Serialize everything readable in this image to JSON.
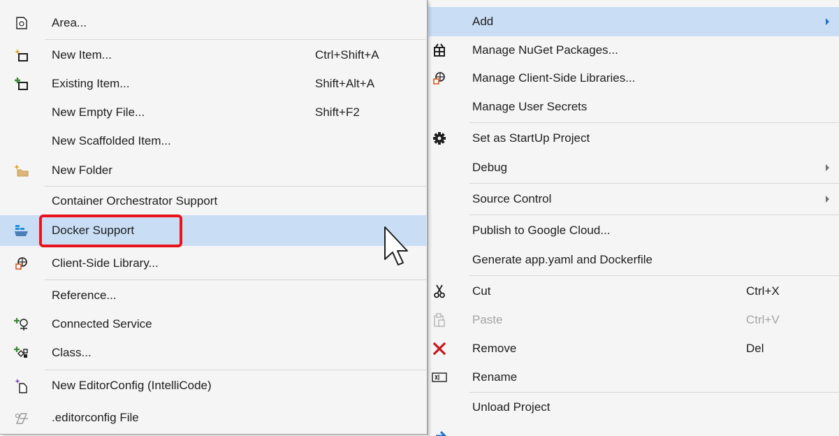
{
  "add_submenu": {
    "items": [
      {
        "label": "Area...",
        "shortcut": "",
        "icon": "area-icon"
      },
      {
        "label": "New Item...",
        "shortcut": "Ctrl+Shift+A",
        "icon": "new-item-icon"
      },
      {
        "label": "Existing Item...",
        "shortcut": "Shift+Alt+A",
        "icon": "existing-item-icon"
      },
      {
        "label": "New Empty File...",
        "shortcut": "Shift+F2",
        "icon": ""
      },
      {
        "label": "New Scaffolded Item...",
        "shortcut": "",
        "icon": ""
      },
      {
        "label": "New Folder",
        "shortcut": "",
        "icon": "new-folder-icon"
      },
      {
        "label": "Container Orchestrator Support",
        "shortcut": "",
        "icon": ""
      },
      {
        "label": "Docker Support",
        "shortcut": "",
        "icon": "docker-icon",
        "highlighted": true
      },
      {
        "label": "Client-Side Library...",
        "shortcut": "",
        "icon": "client-library-icon"
      },
      {
        "label": "Reference...",
        "shortcut": "",
        "icon": ""
      },
      {
        "label": "Connected Service",
        "shortcut": "",
        "icon": "connected-service-icon"
      },
      {
        "label": "Class...",
        "shortcut": "",
        "icon": "class-icon"
      },
      {
        "label": "New EditorConfig (IntelliCode)",
        "shortcut": "",
        "icon": "editorconfig-intellicode-icon"
      },
      {
        "label": ".editorconfig File",
        "shortcut": "",
        "icon": "editorconfig-file-icon"
      }
    ]
  },
  "context_menu": {
    "items": [
      {
        "label": "Add",
        "shortcut": "",
        "submenu": true,
        "highlighted": true
      },
      {
        "label": "Manage NuGet Packages...",
        "shortcut": "",
        "icon": "nuget-icon"
      },
      {
        "label": "Manage Client-Side Libraries...",
        "shortcut": "",
        "icon": "client-library-icon"
      },
      {
        "label": "Manage User Secrets",
        "shortcut": ""
      },
      {
        "label": "Set as StartUp Project",
        "shortcut": "",
        "icon": "gear-icon"
      },
      {
        "label": "Debug",
        "shortcut": "",
        "submenu": true
      },
      {
        "label": "Source Control",
        "shortcut": "",
        "submenu": true
      },
      {
        "label": "Publish to Google Cloud...",
        "shortcut": ""
      },
      {
        "label": "Generate app.yaml and Dockerfile",
        "shortcut": ""
      },
      {
        "label": "Cut",
        "shortcut": "Ctrl+X",
        "icon": "cut-icon"
      },
      {
        "label": "Paste",
        "shortcut": "Ctrl+V",
        "icon": "paste-icon",
        "disabled": true
      },
      {
        "label": "Remove",
        "shortcut": "Del",
        "icon": "remove-icon"
      },
      {
        "label": "Rename",
        "shortcut": "",
        "icon": "rename-icon"
      },
      {
        "label": "Unload Project",
        "shortcut": ""
      }
    ]
  },
  "colors": {
    "menu_background": "#f5f5f5",
    "highlight": "#c9def5",
    "callout_outline": "#e8141b",
    "separator": "#d6d6d6",
    "disabled_text": "#a2a4a5"
  }
}
